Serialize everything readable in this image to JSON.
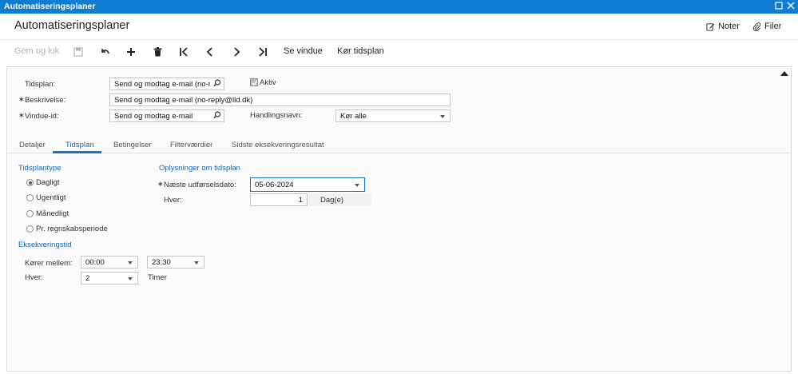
{
  "window": {
    "title": "Automatiseringsplaner"
  },
  "header": {
    "title": "Automatiseringsplaner",
    "notes_label": "Noter",
    "files_label": "Filer"
  },
  "toolbar": {
    "save_close_label": "Gem og luk",
    "see_window_label": "Se vindue",
    "run_schedule_label": "Kør tidsplan"
  },
  "form": {
    "schedule_label": "Tidsplan:",
    "schedule_value": "Send og modtag e-mail (no-reply@lld.dk)",
    "active_label": "Aktiv",
    "active_checked": true,
    "description_label": "Beskrivelse:",
    "description_value": "Send og modtag e-mail (no-reply@lld.dk)",
    "window_id_label": "Vindue-id:",
    "window_id_value": "Send og modtag e-mail",
    "action_name_label": "Handlingsnavn:",
    "action_name_value": "Kør alle"
  },
  "tabs": [
    {
      "label": "Detaljer"
    },
    {
      "label": "Tidsplan",
      "active": true
    },
    {
      "label": "Betingelser"
    },
    {
      "label": "Filterværdier"
    },
    {
      "label": "Sidste eksekveringsresultat"
    }
  ],
  "schedule_tab": {
    "schedule_type_title": "Tidsplantype",
    "schedule_types": [
      {
        "label": "Dagligt",
        "checked": true
      },
      {
        "label": "Ugentligt",
        "checked": false
      },
      {
        "label": "Månedligt",
        "checked": false
      },
      {
        "label": "Pr. regnskabsperiode",
        "checked": false
      }
    ],
    "info_title": "Oplysninger om tidsplan",
    "next_run_label": "Næste udførselsdato:",
    "next_run_value": "05-06-2024",
    "every_label": "Hver:",
    "every_value": "1",
    "every_unit": "Dag(e)",
    "execution_title": "Eksekveringstid",
    "runs_between_label": "Kører mellem:",
    "runs_from": "00:00",
    "runs_to": "23:30",
    "exec_every_label": "Hver:",
    "exec_every_value": "2",
    "exec_every_unit": "Timer"
  },
  "colors": {
    "titlebar": "#0f7dd4",
    "accent": "#1a73c2",
    "section_text": "#1565b8"
  }
}
